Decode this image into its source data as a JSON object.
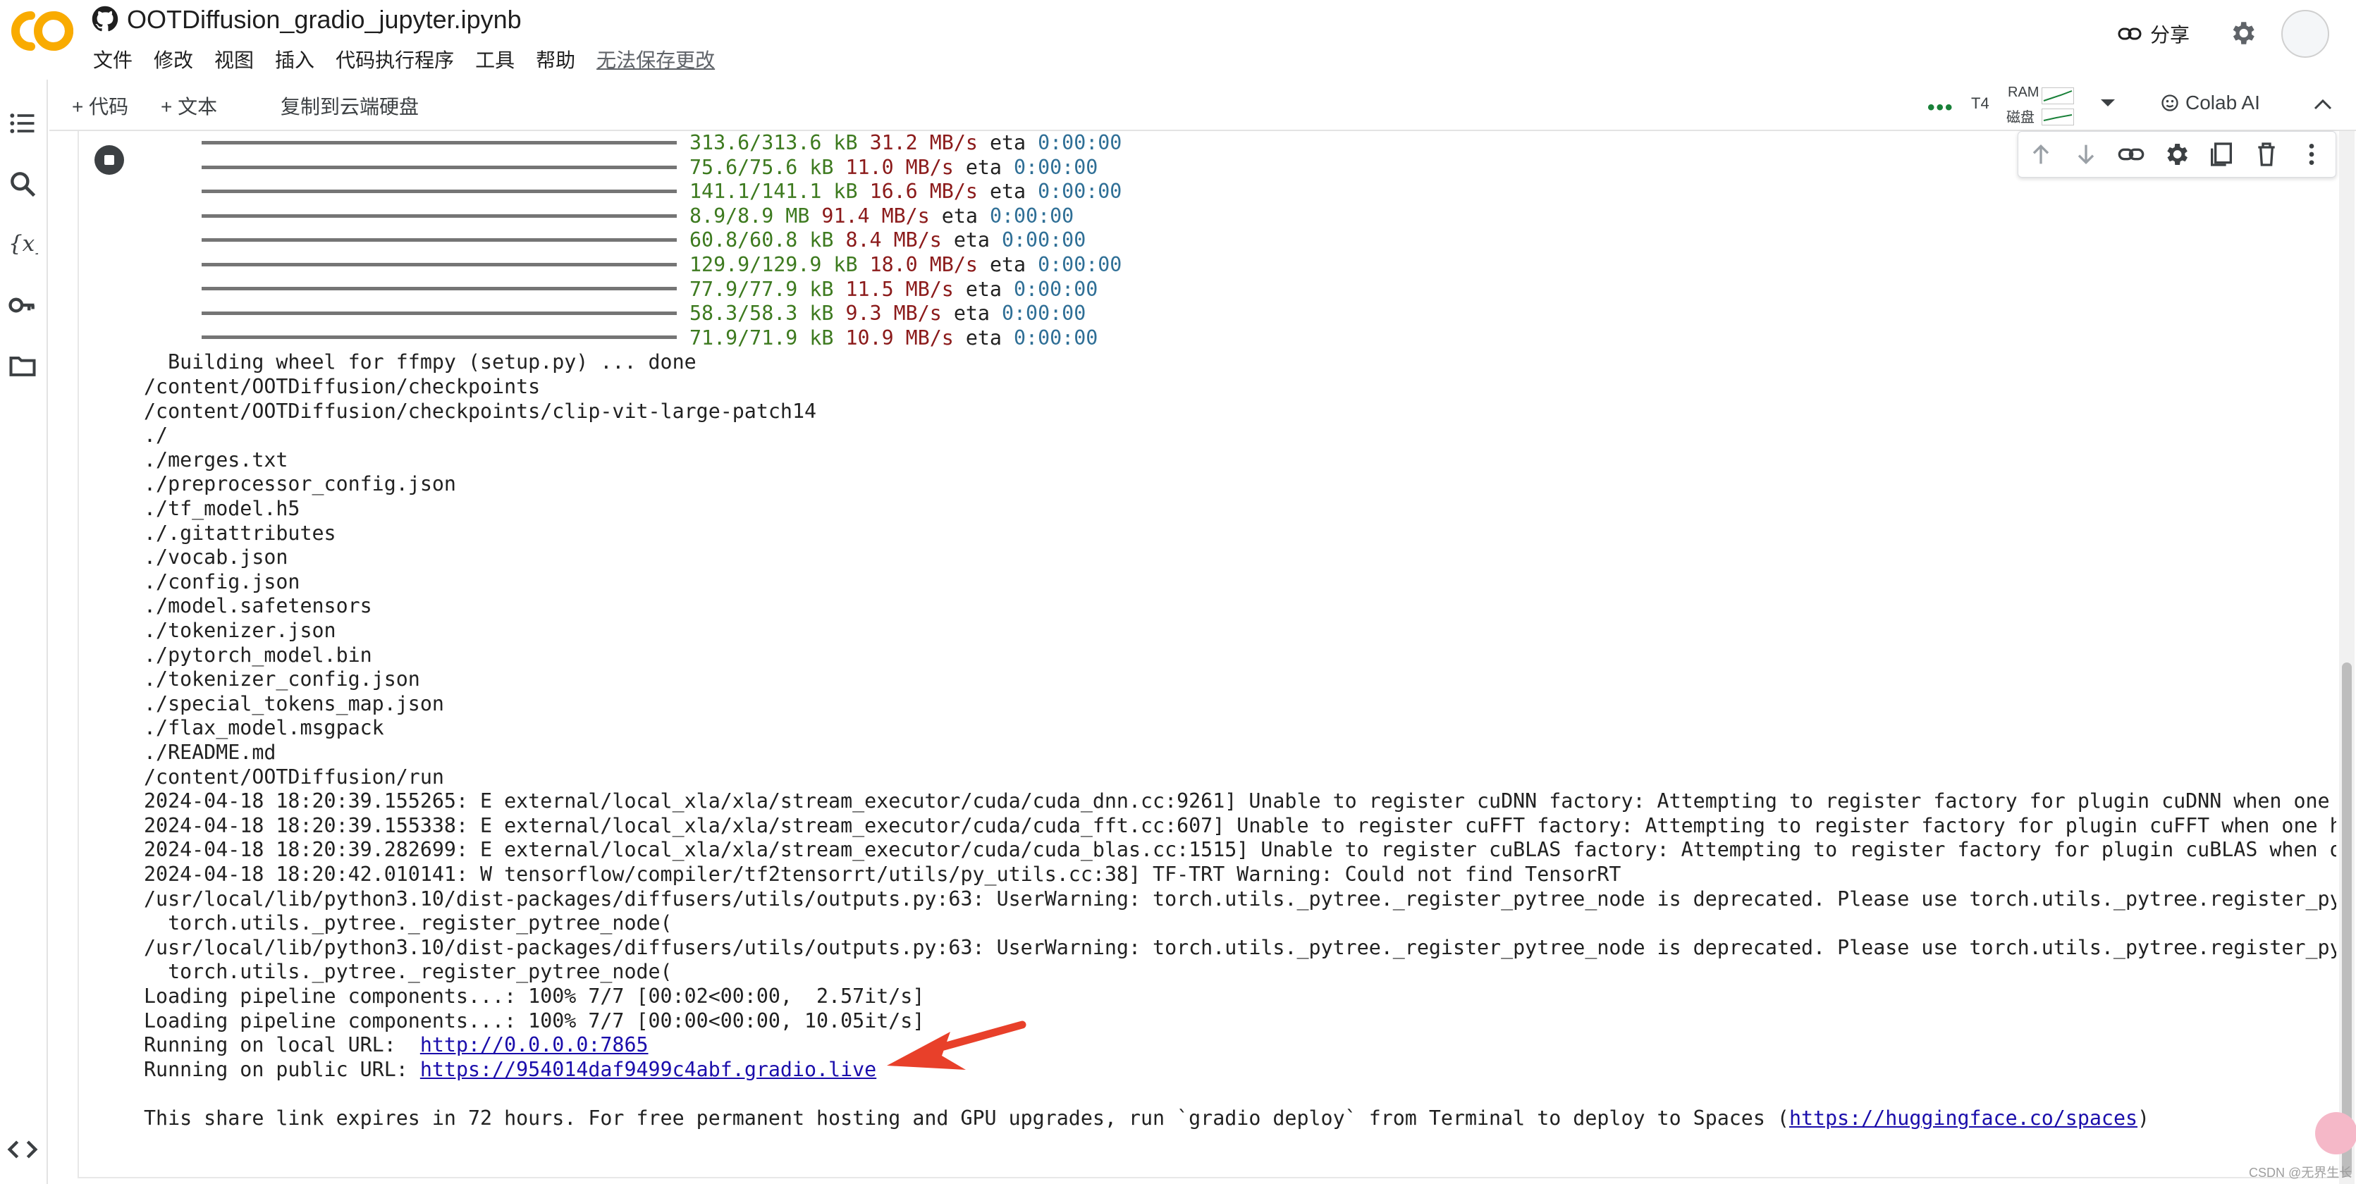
{
  "header": {
    "title": "OOTDiffusion_gradio_jupyter.ipynb",
    "menu": [
      "文件",
      "修改",
      "视图",
      "插入",
      "代码执行程序",
      "工具",
      "帮助"
    ],
    "unsaved_notice": "无法保存更改",
    "share_label": "分享"
  },
  "toolbar": {
    "add_code": "+ 代码",
    "add_text": "+ 文本",
    "copy_drive": "复制到云端硬盘",
    "runtime_type": "T4",
    "ram_label": "RAM",
    "disk_label": "磁盘",
    "colab_ai": "Colab AI"
  },
  "progress": [
    {
      "size": "313.6/313.6 kB",
      "speed": "31.2 MB/s",
      "eta_label": "eta",
      "eta": "0:00:00"
    },
    {
      "size": "75.6/75.6 kB",
      "speed": "11.0 MB/s",
      "eta_label": "eta",
      "eta": "0:00:00"
    },
    {
      "size": "141.1/141.1 kB",
      "speed": "16.6 MB/s",
      "eta_label": "eta",
      "eta": "0:00:00"
    },
    {
      "size": "8.9/8.9 MB",
      "speed": "91.4 MB/s",
      "eta_label": "eta",
      "eta": "0:00:00"
    },
    {
      "size": "60.8/60.8 kB",
      "speed": "8.4 MB/s",
      "eta_label": "eta",
      "eta": "0:00:00"
    },
    {
      "size": "129.9/129.9 kB",
      "speed": "18.0 MB/s",
      "eta_label": "eta",
      "eta": "0:00:00"
    },
    {
      "size": "77.9/77.9 kB",
      "speed": "11.5 MB/s",
      "eta_label": "eta",
      "eta": "0:00:00"
    },
    {
      "size": "58.3/58.3 kB",
      "speed": "9.3 MB/s",
      "eta_label": "eta",
      "eta": "0:00:00"
    },
    {
      "size": "71.9/71.9 kB",
      "speed": "10.9 MB/s",
      "eta_label": "eta",
      "eta": "0:00:00"
    }
  ],
  "lines": [
    "  Building wheel for ffmpy (setup.py) ... done",
    "/content/OOTDiffusion/checkpoints",
    "/content/OOTDiffusion/checkpoints/clip-vit-large-patch14",
    "./",
    "./merges.txt",
    "./preprocessor_config.json",
    "./tf_model.h5",
    "./.gitattributes",
    "./vocab.json",
    "./config.json",
    "./model.safetensors",
    "./tokenizer.json",
    "./pytorch_model.bin",
    "./tokenizer_config.json",
    "./special_tokens_map.json",
    "./flax_model.msgpack",
    "./README.md",
    "/content/OOTDiffusion/run",
    "2024-04-18 18:20:39.155265: E external/local_xla/xla/stream_executor/cuda/cuda_dnn.cc:9261] Unable to register cuDNN factory: Attempting to register factory for plugin cuDNN when one ha",
    "2024-04-18 18:20:39.155338: E external/local_xla/xla/stream_executor/cuda/cuda_fft.cc:607] Unable to register cuFFT factory: Attempting to register factory for plugin cuFFT when one has",
    "2024-04-18 18:20:39.282699: E external/local_xla/xla/stream_executor/cuda/cuda_blas.cc:1515] Unable to register cuBLAS factory: Attempting to register factory for plugin cuBLAS when one",
    "2024-04-18 18:20:42.010141: W tensorflow/compiler/tf2tensorrt/utils/py_utils.cc:38] TF-TRT Warning: Could not find TensorRT",
    "/usr/local/lib/python3.10/dist-packages/diffusers/utils/outputs.py:63: UserWarning: torch.utils._pytree._register_pytree_node is deprecated. Please use torch.utils._pytree.register_pytr",
    "  torch.utils._pytree._register_pytree_node(",
    "/usr/local/lib/python3.10/dist-packages/diffusers/utils/outputs.py:63: UserWarning: torch.utils._pytree._register_pytree_node is deprecated. Please use torch.utils._pytree.register_pytr",
    "  torch.utils._pytree._register_pytree_node(",
    "Loading pipeline components...: 100% 7/7 [00:02<00:00,  2.57it/s]",
    "Loading pipeline components...: 100% 7/7 [00:00<00:00, 10.05it/s]"
  ],
  "urls": {
    "local_prefix": "Running on local URL:  ",
    "local_url": "http://0.0.0.0:7865",
    "public_prefix": "Running on public URL: ",
    "public_url": "https://954014daf9499c4abf.gradio.live",
    "share_text": "This share link expires in 72 hours. For free permanent hosting and GPU upgrades, run `gradio deploy` from Terminal to deploy to Spaces (",
    "spaces_url": "https://huggingface.co/spaces",
    "share_close": ")"
  },
  "watermark": "CSDN @无界生长",
  "colors": {
    "progress_size": "#3d7a1f",
    "progress_speed": "#8b1a1a",
    "progress_eta": "#2f6f96",
    "link": "#1a0dab",
    "arrow": "#e8402a"
  }
}
